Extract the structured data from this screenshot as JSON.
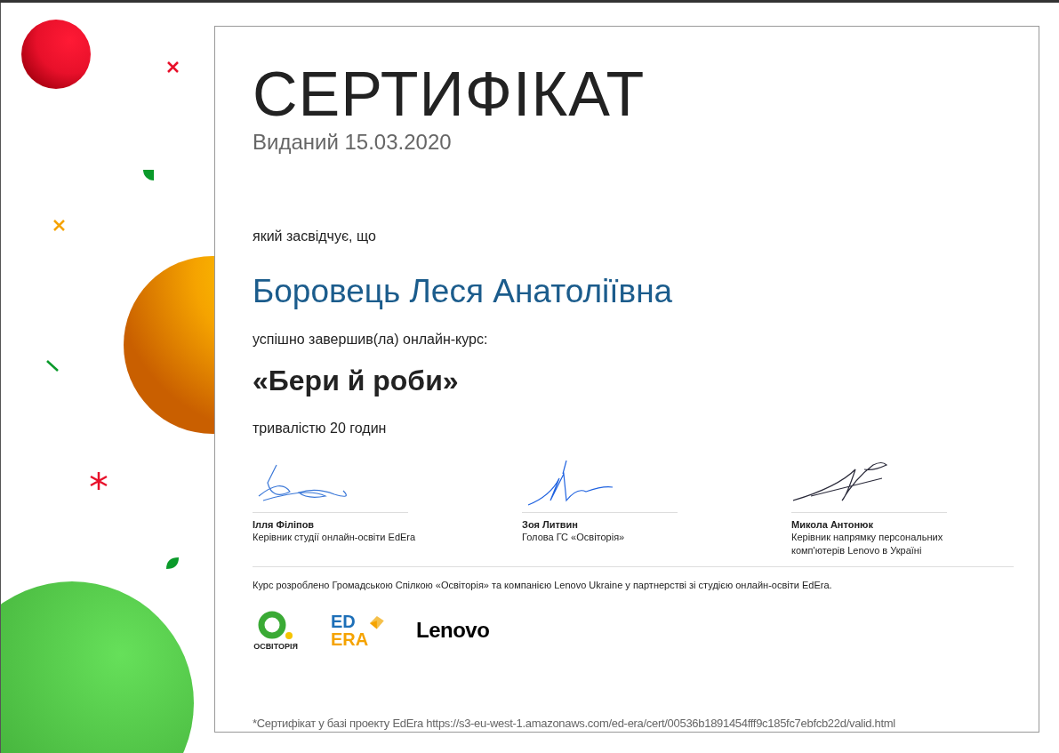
{
  "title": "СЕРТИФІКАТ",
  "issued": "Виданий 15.03.2020",
  "certifies": "який засвідчує, що",
  "recipient": "Боровець Леся Анатоліївна",
  "completed": "успішно завершив(ла) онлайн-курс:",
  "course": "«Бери й роби»",
  "duration": "тривалістю 20 годин",
  "signatories": [
    {
      "name": "Ілля Філіпов",
      "role": "Керівник студії онлайн-освіти EdEra"
    },
    {
      "name": "Зоя Литвин",
      "role": "Голова ГС «Освіторія»"
    },
    {
      "name": "Микола Антонюк",
      "role": "Керівник напрямку персональних комп'ютерів Lenovo в Україні"
    }
  ],
  "partners_note": "Курс розроблено Громадською Спілкою «Освіторія» та компанією Lenovo Ukraine у партнерстві зі студією онлайн-освіти EdEra.",
  "logos": [
    {
      "kind": "osvitoria",
      "text": "ОСВІТОРІЯ"
    },
    {
      "kind": "edera",
      "text": "ED",
      "text2": "ERA"
    },
    {
      "kind": "lenovo",
      "text": "Lenovo"
    }
  ],
  "verification": "*Сертифікат у базі проекту EdEra https://s3-eu-west-1.amazonaws.com/ed-era/cert/00536b1891454fff9c185fc7ebfcb22d/valid.html"
}
